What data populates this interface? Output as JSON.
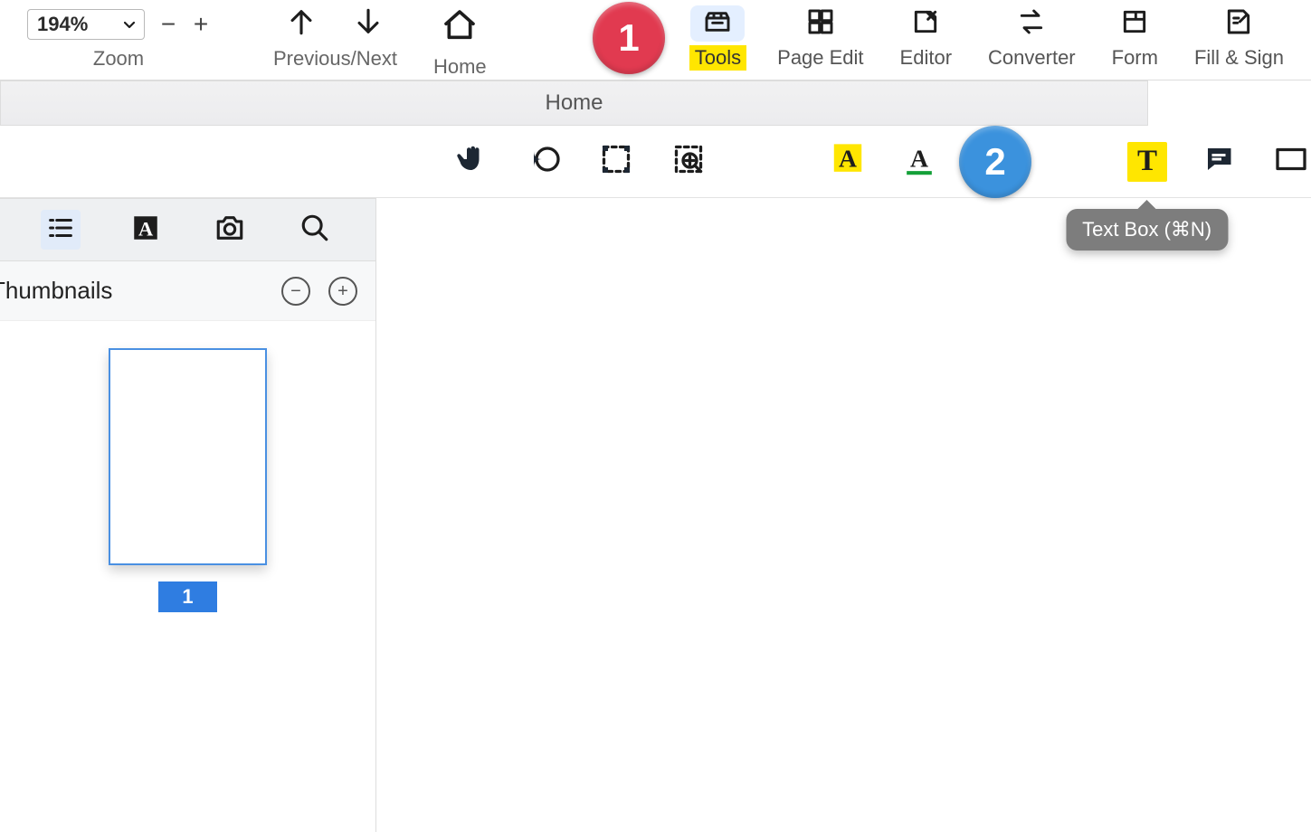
{
  "top": {
    "zoom_value": "194%",
    "zoom_label": "Zoom",
    "prevnext_label": "Previous/Next",
    "home_label": "Home",
    "tabs": {
      "tools": "Tools",
      "page_edit": "Page Edit",
      "editor": "Editor",
      "converter": "Converter",
      "form": "Form",
      "fill_sign": "Fill & Sign"
    }
  },
  "breadcrumb": "Home",
  "tooltip": "Text Box (⌘N)",
  "callouts": {
    "one": "1",
    "two": "2"
  },
  "side": {
    "header": "Thumbnails",
    "thumb_number": "1"
  }
}
